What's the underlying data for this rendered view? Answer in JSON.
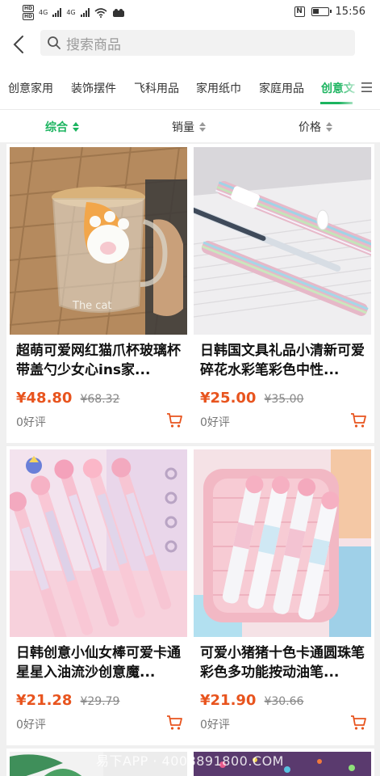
{
  "status_bar": {
    "network_label_1": "HD",
    "network_label_2": "HD",
    "signal_1": "4G",
    "signal_2": "4G",
    "time": "15:56"
  },
  "search": {
    "placeholder": "搜索商品",
    "back_icon": "chevron-left-icon",
    "search_icon": "search-icon"
  },
  "categories": {
    "items": [
      "创意家用",
      "装饰摆件",
      "飞科用品",
      "家用纸巾",
      "家庭用品",
      "创意文"
    ],
    "active_index": 5,
    "menu_icon": "menu-icon"
  },
  "sort": {
    "items": [
      "综合",
      "销量",
      "价格"
    ],
    "active_index": 0
  },
  "colors": {
    "accent": "#1bb45f",
    "price": "#e8541e"
  },
  "products": [
    {
      "title": "超萌可爱网红猫爪杯玻璃杯带盖勺少女心ins家...",
      "price": "¥48.80",
      "old_price": "¥68.32",
      "reviews": "0好评",
      "image_text": "The cat"
    },
    {
      "title": "日韩国文具礼品小清新可爱碎花水彩笔彩色中性...",
      "price": "¥25.00",
      "old_price": "¥35.00",
      "reviews": "0好评",
      "image_text": ""
    },
    {
      "title": "日韩创意小仙女棒可爱卡通星星入油流沙创意魔...",
      "price": "¥21.28",
      "old_price": "¥29.79",
      "reviews": "0好评",
      "image_text": ""
    },
    {
      "title": "可爱小猪猪十色卡通圆珠笔 彩色多功能按动油笔...",
      "price": "¥21.90",
      "old_price": "¥30.66",
      "reviews": "0好评",
      "image_text": ""
    }
  ],
  "watermark": "易下APP · 4008891800.COM"
}
